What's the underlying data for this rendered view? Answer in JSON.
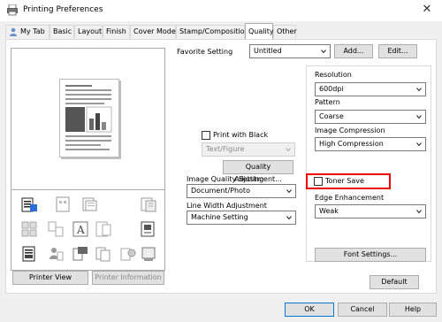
{
  "window": {
    "title": "Printing Preferences",
    "close_glyph": "✕"
  },
  "tabs": [
    {
      "label": "My Tab",
      "active": false
    },
    {
      "label": "Basic",
      "active": false
    },
    {
      "label": "Layout",
      "active": false
    },
    {
      "label": "Finish",
      "active": false
    },
    {
      "label": "Cover Mode",
      "active": false
    },
    {
      "label": "Stamp/Composition",
      "active": false
    },
    {
      "label": "Quality",
      "active": true
    },
    {
      "label": "Other",
      "active": false
    }
  ],
  "favorite": {
    "label": "Favorite Setting",
    "value": "Untitled",
    "add_label": "Add...",
    "edit_label": "Edit..."
  },
  "left": {
    "printer_view_label": "Printer View",
    "printer_information_label": "Printer Information"
  },
  "middle": {
    "print_with_black_label": "Print with Black",
    "print_with_black_checked": false,
    "text_figure_value": "Text/Figure",
    "quality_adjustment_label": "Quality Adjustment...",
    "image_quality_label": "Image Quality Setting",
    "image_quality_value": "Document/Photo",
    "line_width_label": "Line Width Adjustment",
    "line_width_value": "Machine Setting"
  },
  "right": {
    "resolution_label": "Resolution",
    "resolution_value": "600dpi",
    "pattern_label": "Pattern",
    "pattern_value": "Coarse",
    "image_compression_label": "Image Compression",
    "image_compression_value": "High Compression",
    "toner_save_label": "Toner Save",
    "toner_save_checked": false,
    "edge_enhancement_label": "Edge Enhancement",
    "edge_enhancement_value": "Weak",
    "font_settings_label": "Font Settings...",
    "default_label": "Default"
  },
  "footer": {
    "ok_label": "OK",
    "cancel_label": "Cancel",
    "help_label": "Help"
  },
  "colors": {
    "highlight_border": "#e00000",
    "active_tab_border": "#adadad",
    "button_face": "#e1e1e1"
  }
}
